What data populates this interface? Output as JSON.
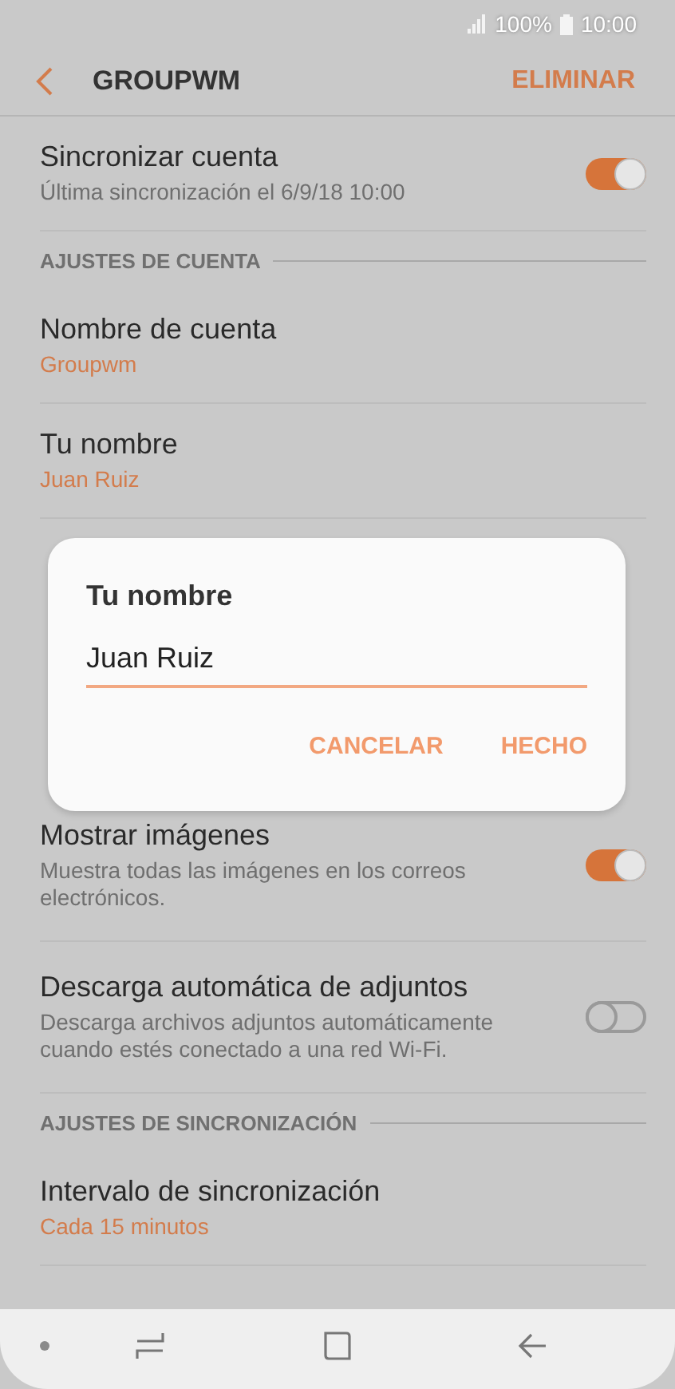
{
  "status_bar": {
    "battery": "100%",
    "time": "10:00"
  },
  "header": {
    "title": "GROUPWM",
    "action": "ELIMINAR"
  },
  "settings": [
    {
      "kind": "toggle",
      "title": "Sincronizar cuenta",
      "subtitle": "Última sincronización el 6/9/18  10:00",
      "on": true
    },
    {
      "kind": "section",
      "title": "AJUSTES DE CUENTA"
    },
    {
      "kind": "value",
      "title": "Nombre de cuenta",
      "value_lines": [
        "Groupwm"
      ]
    },
    {
      "kind": "value",
      "title": "Tu nombre",
      "value_lines": [
        "Juan Ruiz"
      ]
    },
    {
      "kind": "toggle",
      "title": "Mostrar imágenes",
      "subtitle": "Muestra todas las imágenes en los correos electrónicos.",
      "on": true
    },
    {
      "kind": "toggle",
      "title": "Descarga automática de adjuntos",
      "subtitle": "Descarga archivos adjuntos automáticamente cuando estés conectado a una red Wi-Fi.",
      "on": false
    },
    {
      "kind": "section",
      "title": "AJUSTES DE SINCRONIZACIÓN"
    },
    {
      "kind": "value",
      "title": "Intervalo de sincronización",
      "value_lines": [
        "Cada 15 minutos"
      ]
    }
  ],
  "dialog": {
    "title": "Tu nombre",
    "value": "Juan Ruiz",
    "buttons": [
      "CANCELAR",
      "HECHO"
    ]
  }
}
